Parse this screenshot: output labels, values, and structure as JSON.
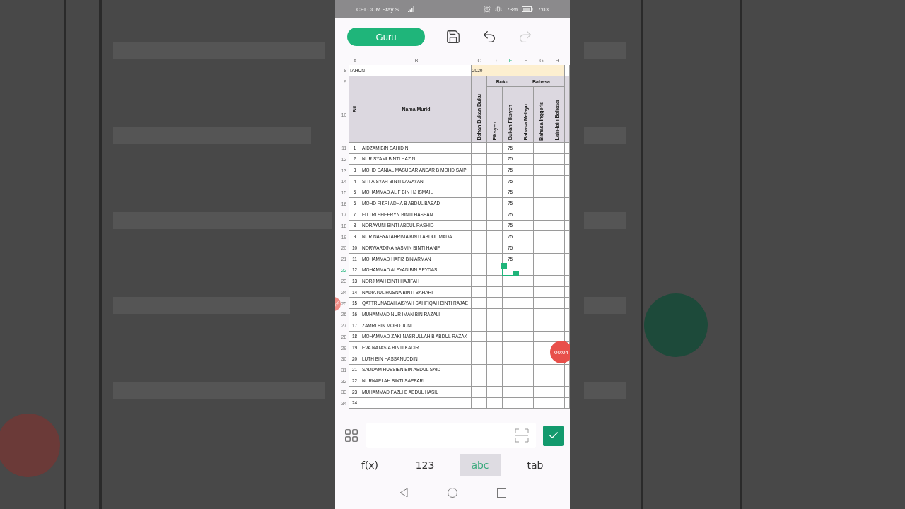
{
  "status_bar": {
    "carrier": "CELCOM Stay S...",
    "battery": "73%",
    "time": "7:03"
  },
  "toolbar": {
    "mode_button": "Guru",
    "redo_disabled": true
  },
  "sheet": {
    "columns": [
      {
        "label": "A",
        "selected": false
      },
      {
        "label": "B",
        "selected": false
      },
      {
        "label": "C",
        "selected": false
      },
      {
        "label": "D",
        "selected": false
      },
      {
        "label": "E",
        "selected": true
      },
      {
        "label": "F",
        "selected": false
      },
      {
        "label": "G",
        "selected": false
      },
      {
        "label": "H",
        "selected": false
      }
    ],
    "year_row": {
      "row_number": "8",
      "label": "TAHUN",
      "value": "2020"
    },
    "header": {
      "row_numbers": [
        "9",
        "10"
      ],
      "bil": "Bil",
      "name": "Nama Murid",
      "groups": [
        "Buku",
        "Bahasa"
      ],
      "vertical": [
        "Bahan Bukan Buku",
        "Fiksyen",
        "Bukan Fiksyen",
        "Bahasa Melayu",
        "Bahasa Inggeris",
        "Lain-lain Bahasa"
      ]
    },
    "rows": [
      {
        "row_number": "11",
        "bil": "1",
        "name": "AIDZAM BIN SAHIDIN",
        "bukan_fiksyen": "75",
        "selected": false
      },
      {
        "row_number": "12",
        "bil": "2",
        "name": "NUR SYAMI BINTI HAZIN",
        "bukan_fiksyen": "75",
        "selected": false
      },
      {
        "row_number": "13",
        "bil": "3",
        "name": "MOHD DANIAL MASUDAR ANSAR B MOHD SAIP",
        "bukan_fiksyen": "75",
        "selected": false
      },
      {
        "row_number": "14",
        "bil": "4",
        "name": "SITI AISYAH BINTI LAGAYAN",
        "bukan_fiksyen": "75",
        "selected": false
      },
      {
        "row_number": "15",
        "bil": "5",
        "name": "MOHAMMAD ALIF BIN HJ ISMAIL",
        "bukan_fiksyen": "75",
        "selected": false
      },
      {
        "row_number": "16",
        "bil": "6",
        "name": "MOHD FIKRI ADHA B ABDUL BASAD",
        "bukan_fiksyen": "75",
        "selected": false
      },
      {
        "row_number": "17",
        "bil": "7",
        "name": "FITTRI SHEERYN BINTI HASSAN",
        "bukan_fiksyen": "75",
        "selected": false
      },
      {
        "row_number": "18",
        "bil": "8",
        "name": "NORAYUNI BINTI ABDUL RASHID",
        "bukan_fiksyen": "75",
        "selected": false
      },
      {
        "row_number": "19",
        "bil": "9",
        "name": "NUR NASYATAHRIMA BINTI ABDUL MADA",
        "bukan_fiksyen": "75",
        "selected": false
      },
      {
        "row_number": "20",
        "bil": "10",
        "name": "NORWARDINA YASMIN BINTI HANIF",
        "bukan_fiksyen": "75",
        "selected": false
      },
      {
        "row_number": "21",
        "bil": "11",
        "name": "MOHAMMAD HAFIZ BIN ARMAN",
        "bukan_fiksyen": "75",
        "selected": false
      },
      {
        "row_number": "22",
        "bil": "12",
        "name": "MOHAMMAD ALFYAN BIN SEYDASI",
        "selected": true
      },
      {
        "row_number": "23",
        "bil": "13",
        "name": "NORJIMAH BINTI HAJIFAH",
        "selected": false
      },
      {
        "row_number": "24",
        "bil": "14",
        "name": "NADIATUL HUSNA BINTI BAHARI",
        "selected": false
      },
      {
        "row_number": "25",
        "bil": "15",
        "name": "QATTRUNADAH AISYAH SAHFIQAH BINTI RAJAE",
        "selected": false
      },
      {
        "row_number": "26",
        "bil": "16",
        "name": "MUHAMMAD NUR IMAN BIN RAZALI",
        "selected": false
      },
      {
        "row_number": "27",
        "bil": "17",
        "name": "ZAMRI BIN MOHD JUNI",
        "selected": false
      },
      {
        "row_number": "28",
        "bil": "18",
        "name": "MOHAMMAD ZAKI NASRULLAH B ABDUL RAZAK",
        "selected": false
      },
      {
        "row_number": "29",
        "bil": "19",
        "name": "EVA NATASIA BINTI KADIR",
        "selected": false
      },
      {
        "row_number": "30",
        "bil": "20",
        "name": "LUTH BIN HASSANUDDIN",
        "selected": false
      },
      {
        "row_number": "31",
        "bil": "21",
        "name": "SADDAM HUSSIEN BIN ABDUL SAID",
        "selected": false
      },
      {
        "row_number": "32",
        "bil": "22",
        "name": "NURNAELAH BINTI SAPPARI",
        "selected": false
      },
      {
        "row_number": "33",
        "bil": "23",
        "name": "MUHAMMAD FAZLI B ABDUL HASIL",
        "selected": false
      },
      {
        "row_number": "34",
        "bil": "24",
        "selected": false
      }
    ]
  },
  "recorder": {
    "timer": "00:04"
  },
  "input_modes": [
    {
      "label": "f(x)",
      "selected": false
    },
    {
      "label": "123",
      "selected": false
    },
    {
      "label": "abc",
      "selected": true
    },
    {
      "label": "tab",
      "selected": false
    }
  ]
}
